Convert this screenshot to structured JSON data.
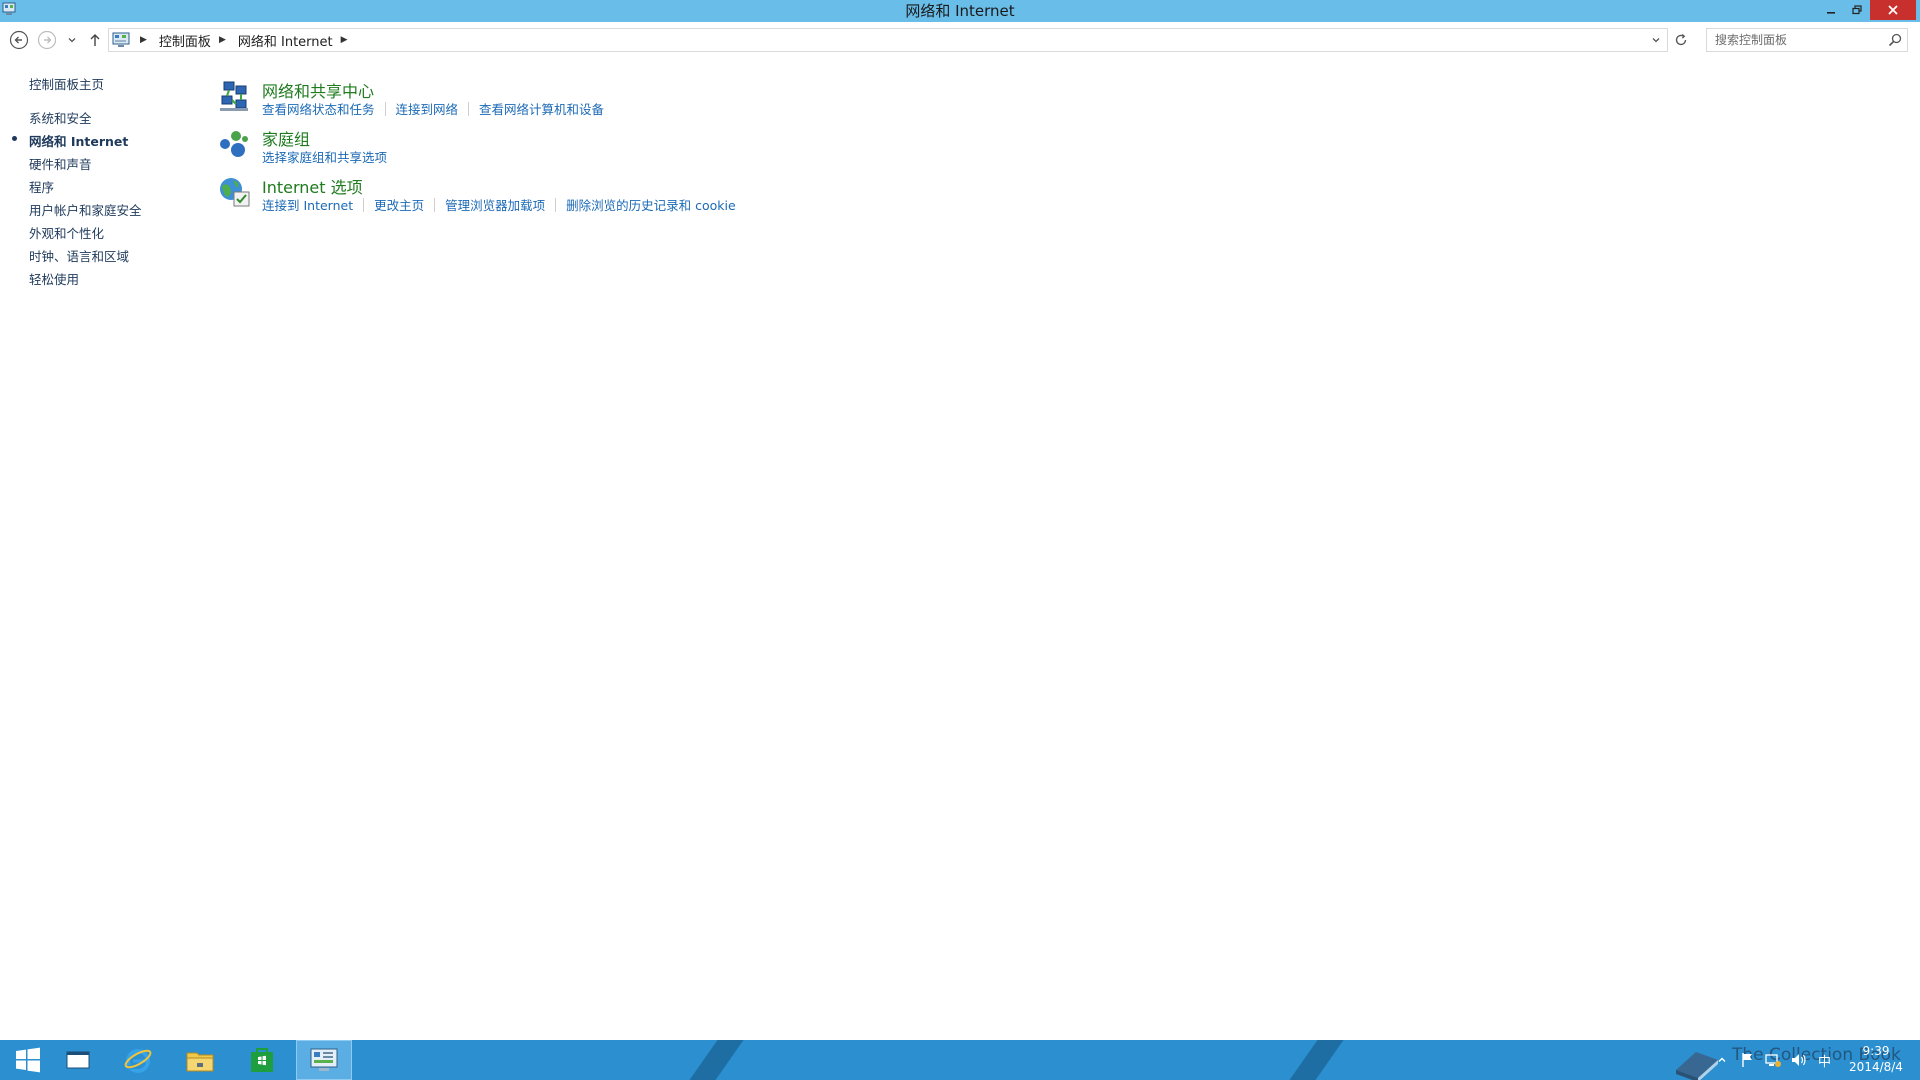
{
  "window": {
    "title": "网络和 Internet",
    "colors": {
      "titlebar": "#69bde9",
      "close": "#c7302c",
      "taskbar": "#2b8fd0"
    }
  },
  "address": {
    "crumbs": [
      "控制面板",
      "网络和 Internet"
    ],
    "search_placeholder": "搜索控制面板"
  },
  "leftnav": {
    "home": "控制面板主页",
    "categories": [
      {
        "label": "系统和安全",
        "active": false
      },
      {
        "label": "网络和 Internet",
        "active": true
      },
      {
        "label": "硬件和声音",
        "active": false
      },
      {
        "label": "程序",
        "active": false
      },
      {
        "label": "用户帐户和家庭安全",
        "active": false
      },
      {
        "label": "外观和个性化",
        "active": false
      },
      {
        "label": "时钟、语言和区域",
        "active": false
      },
      {
        "label": "轻松使用",
        "active": false
      }
    ]
  },
  "groups": [
    {
      "icon": "network-sharing-icon",
      "title": "网络和共享中心",
      "links": [
        "查看网络状态和任务",
        "连接到网络",
        "查看网络计算机和设备"
      ]
    },
    {
      "icon": "homegroup-icon",
      "title": "家庭组",
      "links": [
        "选择家庭组和共享选项"
      ]
    },
    {
      "icon": "internet-options-icon",
      "title": "Internet 选项",
      "links": [
        "连接到 Internet",
        "更改主页",
        "管理浏览器加载项",
        "删除浏览的历史记录和 cookie"
      ]
    }
  ],
  "taskbar": {
    "clock_time": "9:39",
    "clock_date": "2014/8/4",
    "ime": "中",
    "watermark": "The Collection Book"
  }
}
